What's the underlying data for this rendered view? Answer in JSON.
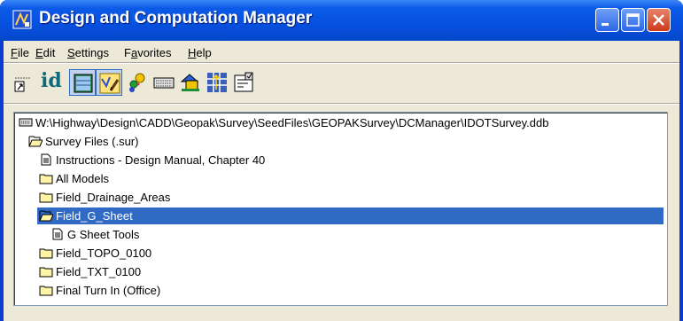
{
  "window": {
    "title": "Design and Computation Manager"
  },
  "menu": [
    {
      "label": "File",
      "u": "F",
      "rest": "ile"
    },
    {
      "label": "Edit",
      "u": "E",
      "rest": "dit"
    },
    {
      "label": "Settings",
      "u": "S",
      "rest": "ettings"
    },
    {
      "label": "Favorites",
      "u": "a",
      "pre": "F",
      "rest": "vorites"
    },
    {
      "label": "Help",
      "u": "H",
      "rest": "elp"
    }
  ],
  "toolbar": {
    "id_label": "id",
    "tools": [
      "pointer-icon",
      "id-icon",
      "dialog-icon",
      "design-mode-icon",
      "palette-icon",
      "keyboard-icon",
      "shapes-icon",
      "grid-icon",
      "settings-icon"
    ]
  },
  "tree": {
    "items": [
      {
        "label": "W:\\Highway\\Design\\CADD\\Geopak\\Survey\\SeedFiles\\GEOPAKSurvey\\DCManager\\IDOTSurvey.ddb",
        "icon": "database-icon",
        "level": 0
      },
      {
        "label": "Survey Files (.sur)",
        "icon": "open-folder-icon",
        "level": 1
      },
      {
        "label": "Instructions  - Design Manual, Chapter 40",
        "icon": "document-icon",
        "level": 2
      },
      {
        "label": "All Models",
        "icon": "folder-icon",
        "level": 2
      },
      {
        "label": "Field_Drainage_Areas",
        "icon": "folder-icon",
        "level": 2
      },
      {
        "label": "Field_G_Sheet",
        "icon": "open-folder-icon",
        "level": 2,
        "selected": true
      },
      {
        "label": "G Sheet Tools",
        "icon": "document-icon",
        "level": 3
      },
      {
        "label": "Field_TOPO_0100",
        "icon": "folder-icon",
        "level": 2
      },
      {
        "label": "Field_TXT_0100",
        "icon": "folder-icon",
        "level": 2
      },
      {
        "label": "Final Turn In (Office)",
        "icon": "folder-icon",
        "level": 2
      }
    ]
  }
}
